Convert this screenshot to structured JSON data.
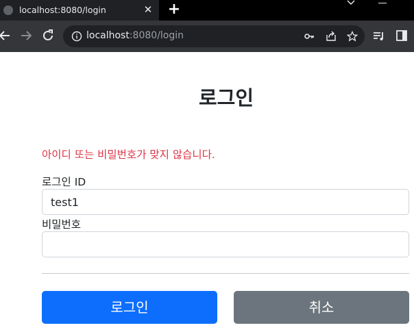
{
  "browser": {
    "tab": {
      "title": "localhost:8080/login",
      "favicon_icon": "globe-icon",
      "close_icon": "close-icon"
    },
    "new_tab_icon": "plus-icon",
    "toolbar": {
      "back_icon": "arrow-left-icon",
      "forward_icon": "arrow-right-icon",
      "reload_icon": "reload-icon",
      "url_host": "localhost",
      "url_rest": ":8080/login",
      "site_info_icon": "info-icon",
      "omnibox_icons": [
        "key-icon",
        "share-icon",
        "star-icon"
      ],
      "extra_icons": [
        "media-control-icon",
        "side-panel-icon"
      ]
    }
  },
  "page": {
    "title": "로그인",
    "error_message": "아이디 또는 비밀번호가 맞지 않습니다.",
    "form": {
      "login_id_label": "로그인 ID",
      "login_id_value": "test1",
      "password_label": "비밀번호",
      "password_value": ""
    },
    "buttons": {
      "login_label": "로그인",
      "cancel_label": "취소"
    }
  },
  "colors": {
    "error": "#dc3545",
    "primary": "#0d6efd",
    "secondary": "#6c757d",
    "text": "#212529"
  }
}
